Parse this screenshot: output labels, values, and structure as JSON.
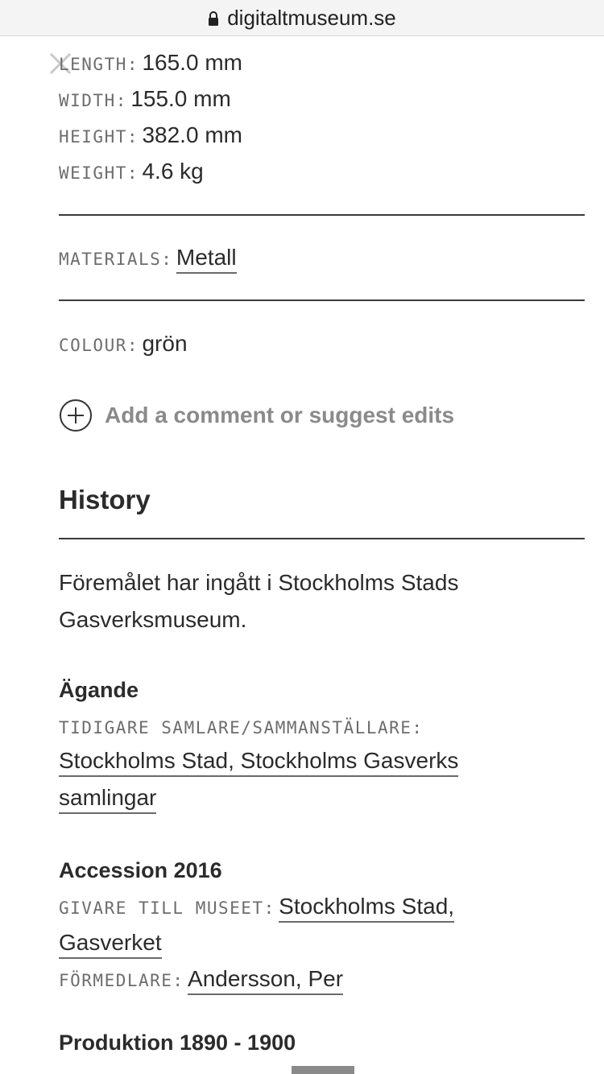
{
  "browser": {
    "url": "digitaltmuseum.se"
  },
  "measurements": [
    {
      "label": "LENGTH:",
      "value": "165.0 mm"
    },
    {
      "label": "WIDTH:",
      "value": "155.0 mm"
    },
    {
      "label": "HEIGHT:",
      "value": "382.0 mm"
    },
    {
      "label": "WEIGHT:",
      "value": "4.6 kg"
    }
  ],
  "materials": {
    "label": "MATERIALS:",
    "value": "Metall"
  },
  "colour": {
    "label": "COLOUR:",
    "value": "grön"
  },
  "comment_action": {
    "label": "Add a comment or suggest edits"
  },
  "history": {
    "title": "History",
    "text_line1": "Föremålet har ingått i Stockholms Stads",
    "text_line2": "Gasverksmuseum."
  },
  "agande": {
    "title": "Ägande",
    "label": "TIDIGARE SAMLARE/SAMMANSTÄLLARE:",
    "link_line1": "Stockholms Stad, Stockholms Gasverks",
    "link_line2": "samlingar"
  },
  "accession": {
    "title": "Accession 2016",
    "donor_label": "GIVARE TILL MUSEET:",
    "donor_line1": "Stockholms Stad,",
    "donor_line2": "Gasverket",
    "mediator_label": "FÖRMEDLARE:",
    "mediator_value": "Andersson, Per"
  },
  "produktion": {
    "title": "Produktion 1890 - 1900"
  },
  "colors": {
    "text": "#2b2b2b",
    "label": "#6d6d6d",
    "muted": "#8a8a8a",
    "rule": "#3a3a3a"
  }
}
